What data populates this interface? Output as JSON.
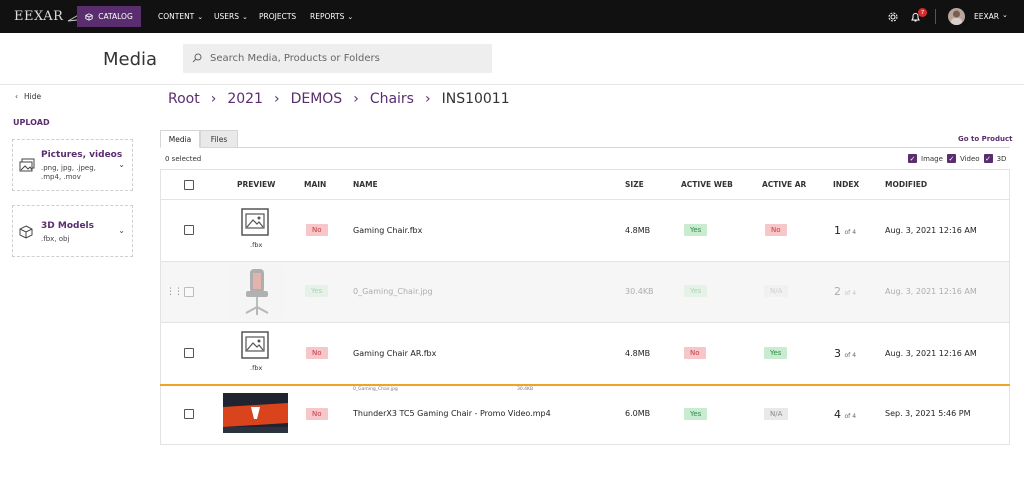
{
  "app": {
    "logo": "EEXAR",
    "catalog": "CATALOG",
    "nav": [
      {
        "label": "CONTENT",
        "dropdown": true
      },
      {
        "label": "USERS",
        "dropdown": true
      },
      {
        "label": "PROJECTS",
        "dropdown": false
      },
      {
        "label": "REPORTS",
        "dropdown": true
      }
    ],
    "notifications_count": "7",
    "user": "EEXAR"
  },
  "header": {
    "title": "Media",
    "search_placeholder": "Search Media, Products or Folders"
  },
  "sidebar": {
    "hide": "Hide",
    "upload": "UPLOAD",
    "cards": [
      {
        "title": "Pictures, videos",
        "sub1": ".png, jpg, .jpeg,",
        "sub2": ".mp4, .mov",
        "icon": "images-icon"
      },
      {
        "title": "3D Models",
        "sub1": ".fbx, obj",
        "sub2": "",
        "icon": "cube-icon"
      }
    ]
  },
  "breadcrumb": [
    "Root",
    "2021",
    "DEMOS",
    "Chairs",
    "INS10011"
  ],
  "tabs": {
    "media": "Media",
    "files": "Files",
    "goto": "Go to Product"
  },
  "toolbar": {
    "selected": "0 selected",
    "filters": [
      "Image",
      "Video",
      "3D"
    ]
  },
  "table": {
    "headers": [
      "PREVIEW",
      "MAIN",
      "NAME",
      "SIZE",
      "ACTIVE WEB",
      "ACTIVE AR",
      "INDEX",
      "MODIFIED"
    ],
    "rows": [
      {
        "preview": ".fbx",
        "main": "No",
        "name": "Gaming Chair.fbx",
        "size": "4.8MB",
        "web": "Yes",
        "ar": "No",
        "index": "1",
        "of": "of 4",
        "modified": "Aug. 3, 2021 12:16 AM"
      },
      {
        "preview": "",
        "main": "Yes",
        "name": "0_Gaming_Chair.jpg",
        "size": "30.4KB",
        "web": "Yes",
        "ar": "N/A",
        "index": "2",
        "of": "of 4",
        "modified": "Aug. 3, 2021 12:16 AM"
      },
      {
        "preview": ".fbx",
        "main": "No",
        "name": "Gaming Chair AR.fbx",
        "size": "4.8MB",
        "web": "No",
        "ar": "Yes",
        "index": "3",
        "of": "of 4",
        "modified": "Aug. 3, 2021 12:16 AM"
      },
      {
        "preview": "",
        "main": "No",
        "name": "ThunderX3 TC5 Gaming Chair - Promo Video.mp4",
        "size": "6.0MB",
        "web": "Yes",
        "ar": "N/A",
        "index": "4",
        "of": "of 4",
        "modified": "Sep. 3, 2021 5:46 PM"
      }
    ],
    "ghost": {
      "name": "0_Gaming_Chair.jpg",
      "size": "30.4KB"
    }
  },
  "colors": {
    "brand": "#5a2e6e",
    "drop_line": "#f0a325"
  }
}
